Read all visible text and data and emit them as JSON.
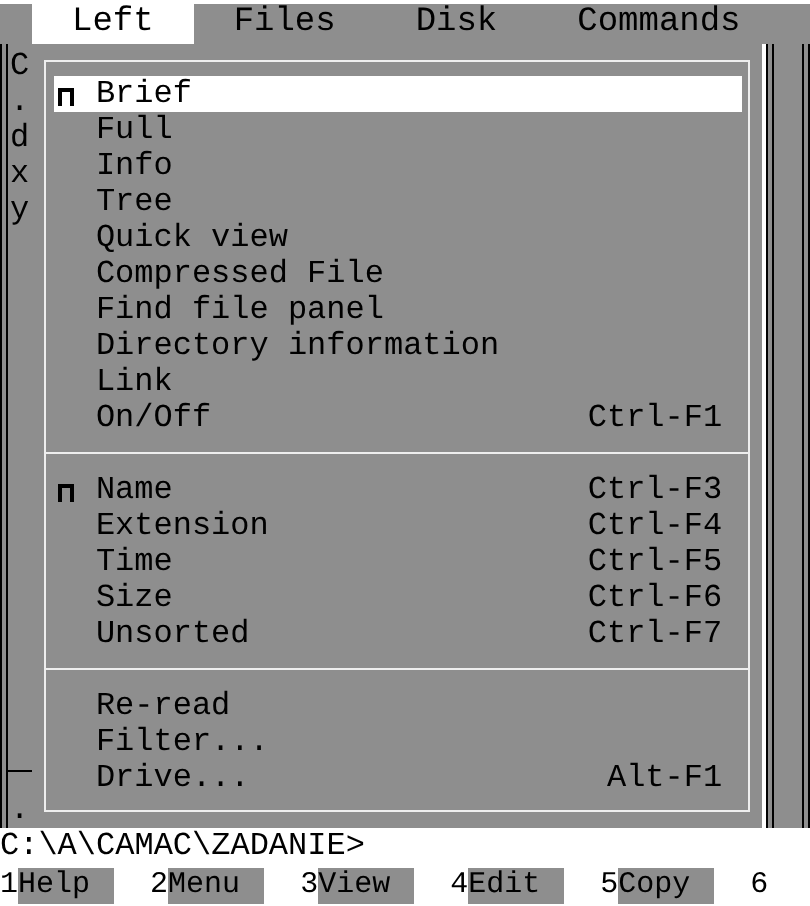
{
  "menu_bar": [
    {
      "label": "Left",
      "selected": true
    },
    {
      "label": "Files",
      "selected": false
    },
    {
      "label": "Disk",
      "selected": false
    },
    {
      "label": "Commands",
      "selected": false
    }
  ],
  "left_panel": {
    "column_text": [
      "C",
      ".",
      "d",
      "x",
      "y"
    ],
    "bottom_text": "."
  },
  "menu": {
    "sections": [
      [
        {
          "label": "Brief",
          "checked": true,
          "selected": true
        },
        {
          "label": "Full",
          "checked": false,
          "selected": false
        },
        {
          "label": "Info",
          "checked": false,
          "selected": false
        },
        {
          "label": "Tree",
          "checked": false,
          "selected": false
        },
        {
          "label": "Quick view",
          "checked": false,
          "selected": false
        },
        {
          "label": "Compressed File",
          "checked": false,
          "selected": false
        },
        {
          "label": "Find file panel",
          "checked": false,
          "selected": false
        },
        {
          "label": "Directory information",
          "checked": false,
          "selected": false
        },
        {
          "label": "Link",
          "checked": false,
          "selected": false
        },
        {
          "label": "On/Off",
          "shortcut": "Ctrl-F1",
          "checked": false,
          "selected": false
        }
      ],
      [
        {
          "label": "Name",
          "shortcut": "Ctrl-F3",
          "checked": true,
          "selected": false
        },
        {
          "label": "Extension",
          "shortcut": "Ctrl-F4",
          "checked": false,
          "selected": false
        },
        {
          "label": "Time",
          "shortcut": "Ctrl-F5",
          "checked": false,
          "selected": false
        },
        {
          "label": "Size",
          "shortcut": "Ctrl-F6",
          "checked": false,
          "selected": false
        },
        {
          "label": "Unsorted",
          "shortcut": "Ctrl-F7",
          "checked": false,
          "selected": false
        }
      ],
      [
        {
          "label": "Re-read",
          "checked": false,
          "selected": false
        },
        {
          "label": "Filter...",
          "checked": false,
          "selected": false
        },
        {
          "label": "Drive...",
          "shortcut": "Alt-F1",
          "checked": false,
          "selected": false
        }
      ]
    ]
  },
  "prompt": "C:\\A\\CAMAC\\ZADANIE>",
  "function_keys": [
    {
      "number": "1",
      "label": "Help"
    },
    {
      "number": "2",
      "label": "Menu"
    },
    {
      "number": "3",
      "label": "View"
    },
    {
      "number": "4",
      "label": "Edit"
    },
    {
      "number": "5",
      "label": "Copy"
    },
    {
      "number": "6"
    }
  ]
}
